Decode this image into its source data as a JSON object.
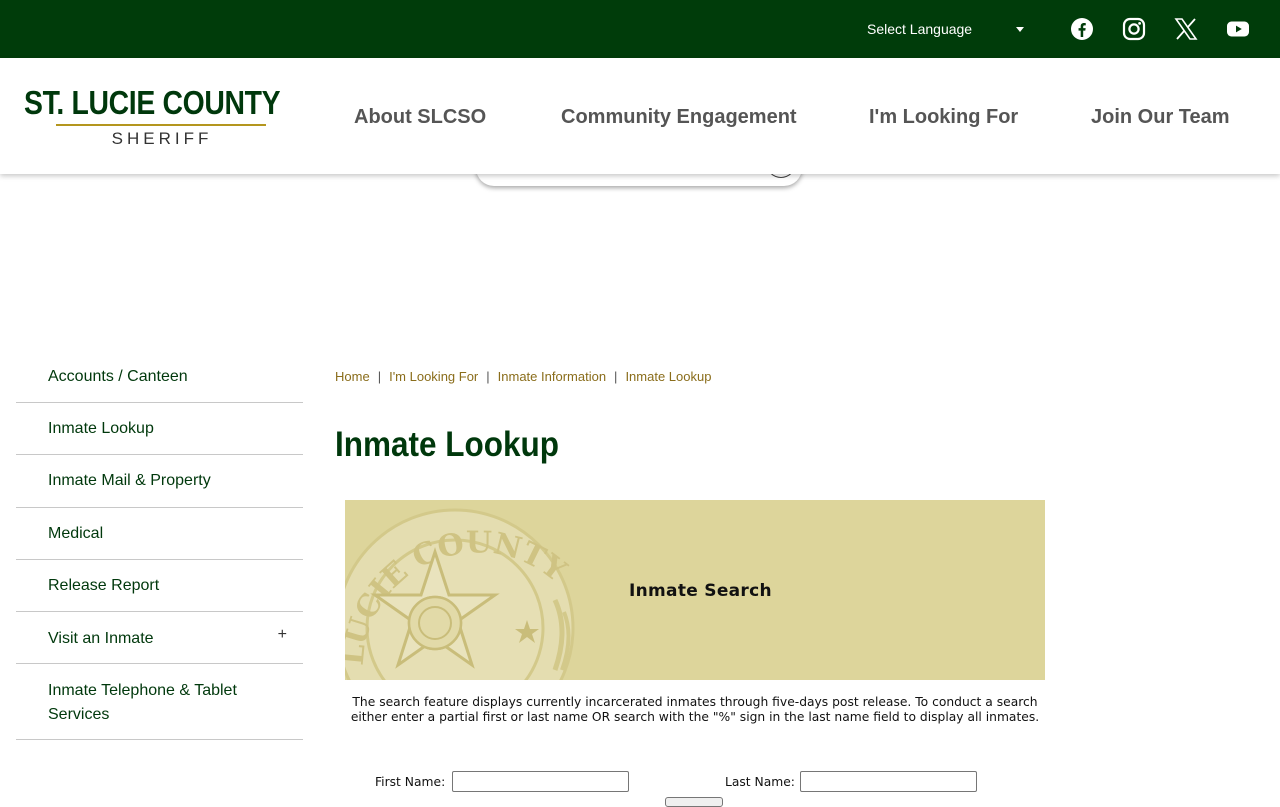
{
  "topbar": {
    "language_label": "Select Language",
    "social": [
      {
        "name": "facebook-icon"
      },
      {
        "name": "instagram-icon"
      },
      {
        "name": "x-icon"
      },
      {
        "name": "youtube-icon"
      }
    ]
  },
  "logo": {
    "main": "ST. LUCIE COUNTY",
    "sub": "SHERIFF"
  },
  "nav": {
    "about": "About SLCSO",
    "community": "Community Engagement",
    "looking": "I'm Looking For",
    "join": "Join Our Team"
  },
  "sidebar": {
    "items": [
      {
        "label": "Accounts / Canteen"
      },
      {
        "label": "Inmate Lookup"
      },
      {
        "label": "Inmate Mail & Property"
      },
      {
        "label": "Medical"
      },
      {
        "label": "Release Report"
      },
      {
        "label": "Visit an Inmate",
        "expand": "+"
      },
      {
        "label": "Inmate Telephone & Tablet Services"
      }
    ]
  },
  "breadcrumb": {
    "items": [
      "Home",
      "I'm Looking For",
      "Inmate Information",
      "Inmate Lookup"
    ],
    "separator": "|"
  },
  "page_title": "Inmate Lookup",
  "banner": {
    "title": "Inmate Search",
    "seal_text": "LUCIE COUNTY"
  },
  "description": "The search feature displays currently incarcerated inmates through five-days post release. To conduct a search either enter a partial first or last name OR search with the \"%\" sign in the last name field to display all inmates.",
  "form": {
    "first_name_label": "First Name:",
    "last_name_label": "Last Name:",
    "first_name_value": "",
    "last_name_value": ""
  },
  "colors": {
    "topbar": "#003c0a",
    "brand_green": "#00380c",
    "gold": "#b4961e",
    "banner": "#ddd59b",
    "breadcrumb": "#8a6d1b"
  }
}
